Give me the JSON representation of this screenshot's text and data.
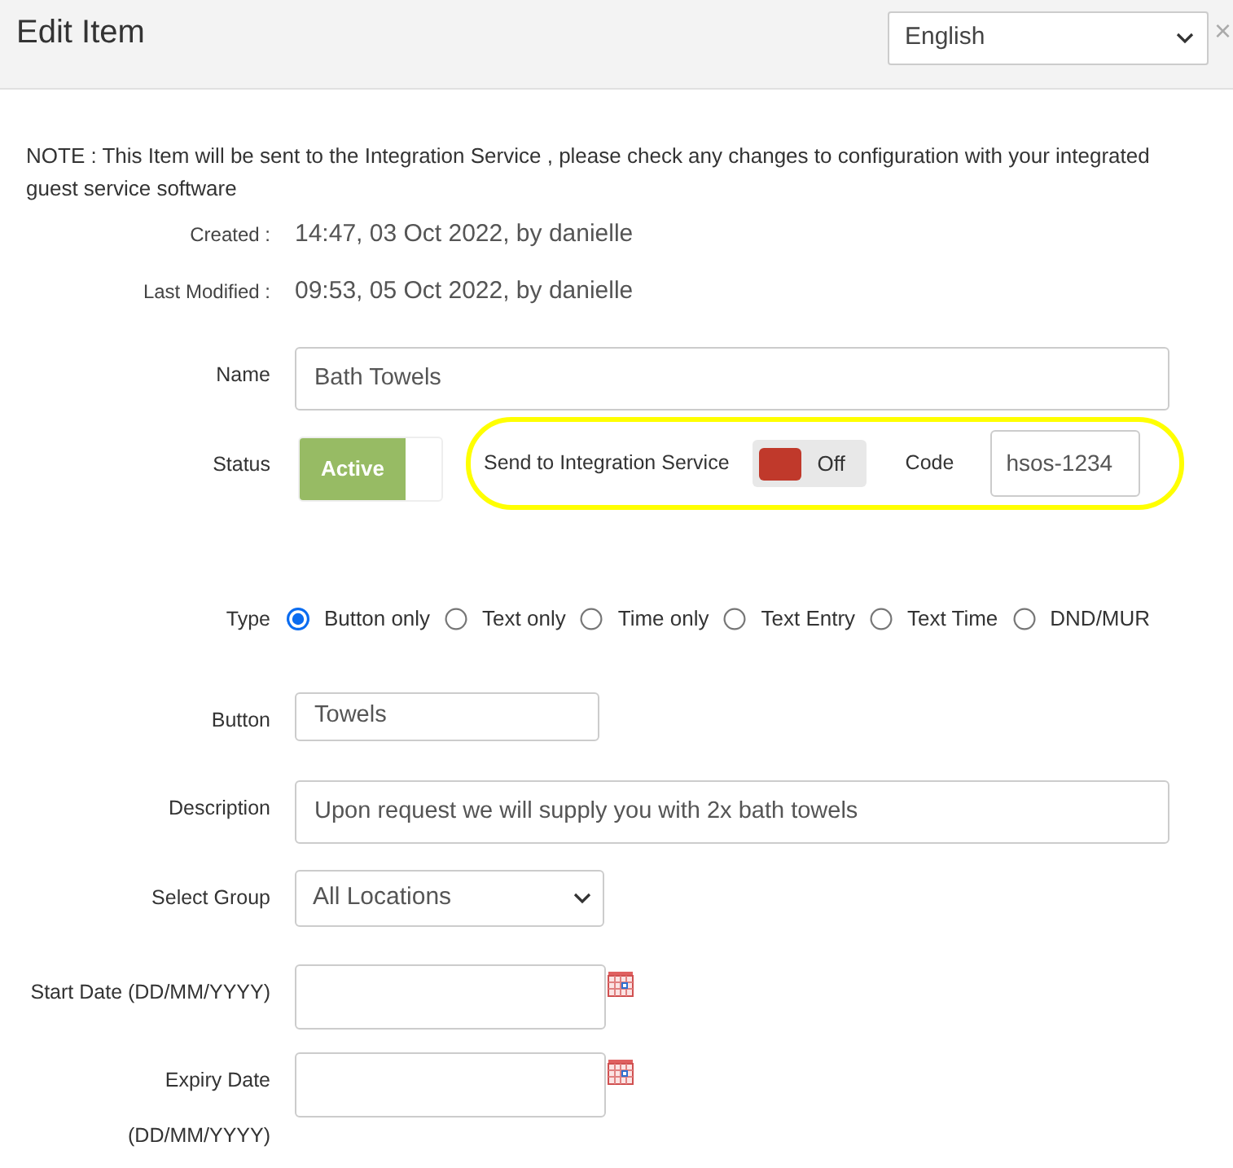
{
  "header": {
    "title": "Edit Item",
    "language": "English",
    "close": "×"
  },
  "note": "NOTE : This Item will be sent to the Integration Service , please check any changes to configuration with your integrated guest service software",
  "meta": [
    {
      "label": "Created :",
      "value": "14:47, 03 Oct 2022, by danielle"
    },
    {
      "label": "Last Modified :",
      "value": "09:53, 05 Oct 2022, by danielle"
    }
  ],
  "form": [
    {
      "kind": "wide_text",
      "label": "Name",
      "value": "Bath Towels"
    },
    {
      "kind": "status",
      "label": "Status",
      "toggle": {
        "label": "Active",
        "on": true
      },
      "integration": {
        "highlighted": true,
        "label": "Send to Integration Service",
        "toggle": {
          "label": "Off",
          "on": false
        },
        "code_label": "Code",
        "code_value": "hsos-1234"
      }
    },
    {
      "kind": "radio",
      "label": "Type",
      "options": [
        {
          "label": "Button only",
          "selected": true
        },
        {
          "label": "Text only",
          "selected": false
        },
        {
          "label": "Time only",
          "selected": false
        },
        {
          "label": "Text Entry",
          "selected": false
        },
        {
          "label": "Text Time",
          "selected": false
        },
        {
          "label": "DND/MUR",
          "selected": false
        }
      ]
    },
    {
      "kind": "short_text",
      "label": "Button",
      "value": "Towels"
    },
    {
      "kind": "wide_text",
      "label": "Description",
      "value": "Upon request we will supply you with 2x bath towels"
    },
    {
      "kind": "select",
      "label": "Select Group",
      "value": "All Locations"
    },
    {
      "kind": "date",
      "label": "Start Date (DD/MM/YYYY)"
    },
    {
      "kind": "date",
      "label": "Expiry Date (DD/MM/YYYY)"
    }
  ]
}
